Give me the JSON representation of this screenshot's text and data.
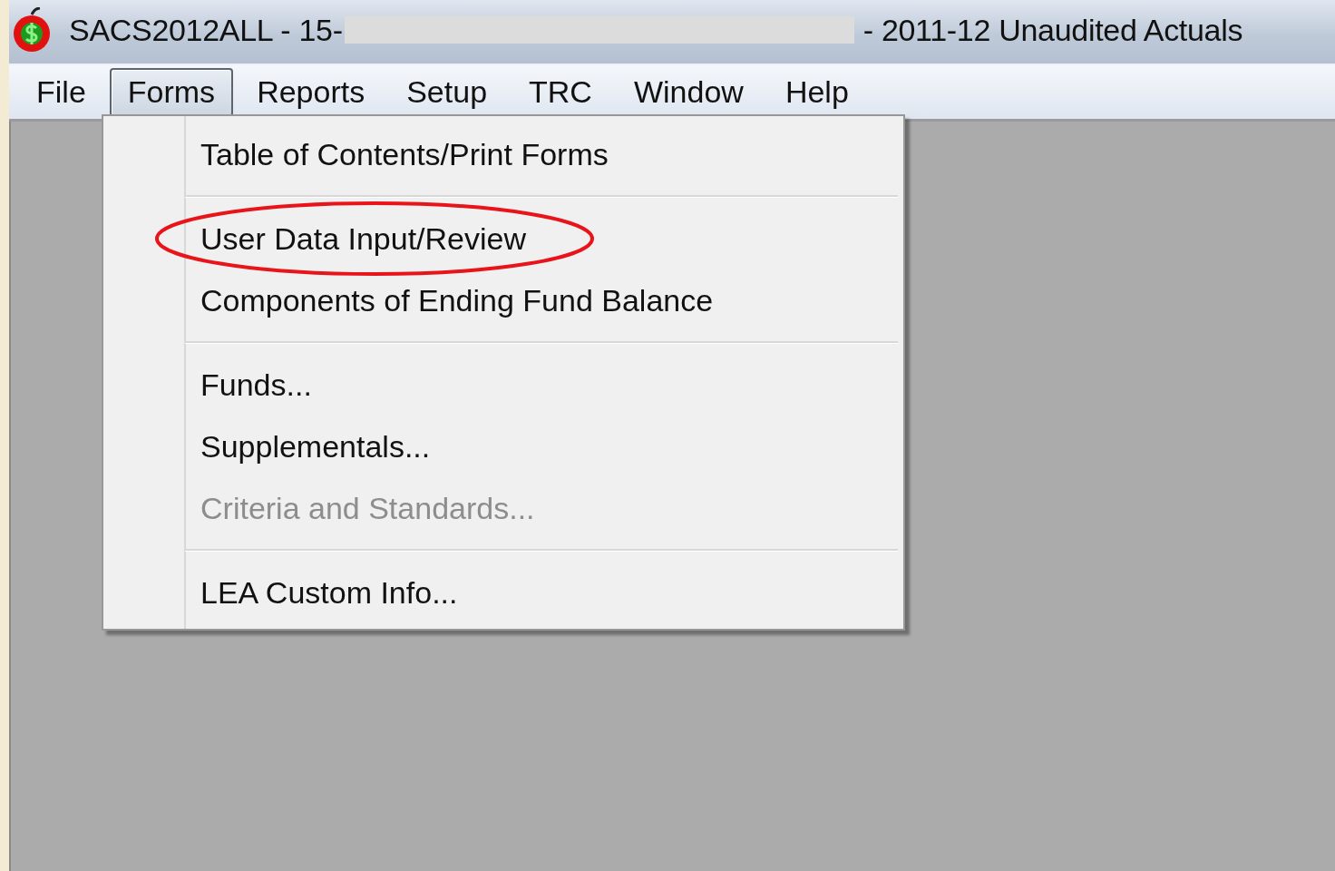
{
  "window": {
    "title_start": "SACS2012ALL - 15-",
    "title_end": "- 2011-12 Unaudited Actuals"
  },
  "menu_bar": [
    {
      "label": "File",
      "selected": false
    },
    {
      "label": "Forms",
      "selected": true
    },
    {
      "label": "Reports",
      "selected": false
    },
    {
      "label": "Setup",
      "selected": false
    },
    {
      "label": "TRC",
      "selected": false
    },
    {
      "label": "Window",
      "selected": false
    },
    {
      "label": "Help",
      "selected": false
    }
  ],
  "dropdown": {
    "items": [
      {
        "kind": "item",
        "label": "Table of Contents/Print Forms",
        "disabled": false,
        "circled": false
      },
      {
        "kind": "separator"
      },
      {
        "kind": "item",
        "label": "User Data Input/Review",
        "disabled": false,
        "circled": true
      },
      {
        "kind": "item",
        "label": "Components of Ending Fund Balance",
        "disabled": false,
        "circled": false
      },
      {
        "kind": "separator"
      },
      {
        "kind": "item",
        "label": "Funds...",
        "disabled": false,
        "circled": false
      },
      {
        "kind": "item",
        "label": "Supplementals...",
        "disabled": false,
        "circled": false
      },
      {
        "kind": "item",
        "label": "Criteria and Standards...",
        "disabled": true,
        "circled": false
      },
      {
        "kind": "separator"
      },
      {
        "kind": "item",
        "label": "LEA Custom Info...",
        "disabled": false,
        "circled": false
      }
    ]
  }
}
